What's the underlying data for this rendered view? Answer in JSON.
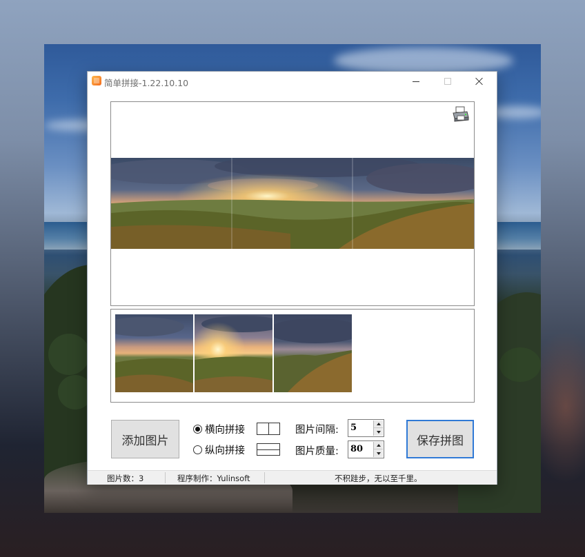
{
  "window": {
    "title": "简单拼接-1.22.10.10"
  },
  "preview": {
    "print_icon": "printer-icon"
  },
  "thumbnails": {
    "count": 3
  },
  "controls": {
    "add_button": "添加图片",
    "save_button": "保存拼图",
    "horizontal_label": "横向拼接",
    "vertical_label": "纵向拼接",
    "horizontal_selected": true,
    "spacing_label": "图片间隔:",
    "spacing_value": "5",
    "quality_label": "图片质量:",
    "quality_value": "80"
  },
  "status": {
    "image_count": "图片数：3",
    "author": "程序制作：Yulinsoft",
    "motto": "不积跬步，无以至千里。"
  },
  "colors": {
    "accent": "#2f79d6",
    "window_bg": "#ffffff",
    "statusbar_bg": "#f0f0f0",
    "button_bg": "#e1e1e1"
  }
}
